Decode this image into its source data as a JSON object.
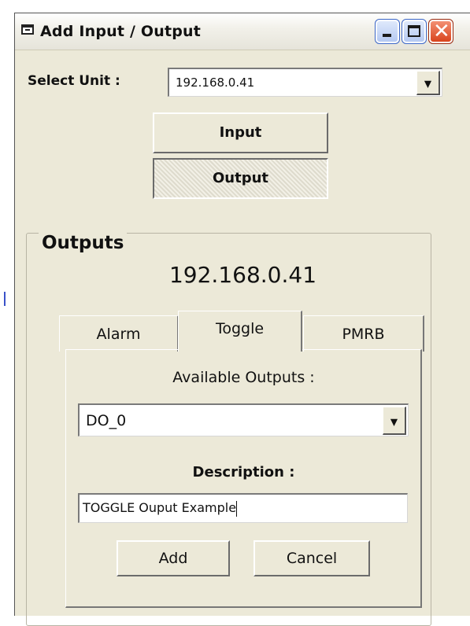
{
  "window": {
    "title": "Add Input / Output"
  },
  "select_unit": {
    "label": "Select Unit :",
    "value": "192.168.0.41"
  },
  "mode_buttons": {
    "input": "Input",
    "output": "Output"
  },
  "outputs_group": {
    "title": "Outputs",
    "unit_ip": "192.168.0.41",
    "tabs": [
      {
        "label": "Alarm"
      },
      {
        "label": "Toggle"
      },
      {
        "label": "PMRB"
      }
    ],
    "active_tab": "Toggle"
  },
  "toggle_panel": {
    "available_label": "Available Outputs :",
    "available_value": "DO_0",
    "description_label": "Description :",
    "description_value": "TOGGLE Ouput Example",
    "add_label": "Add",
    "cancel_label": "Cancel"
  },
  "colors": {
    "dialog_bg": "#ece9d8",
    "close_button": "#d9441d",
    "titlebar_button": "#b5c9f2"
  }
}
